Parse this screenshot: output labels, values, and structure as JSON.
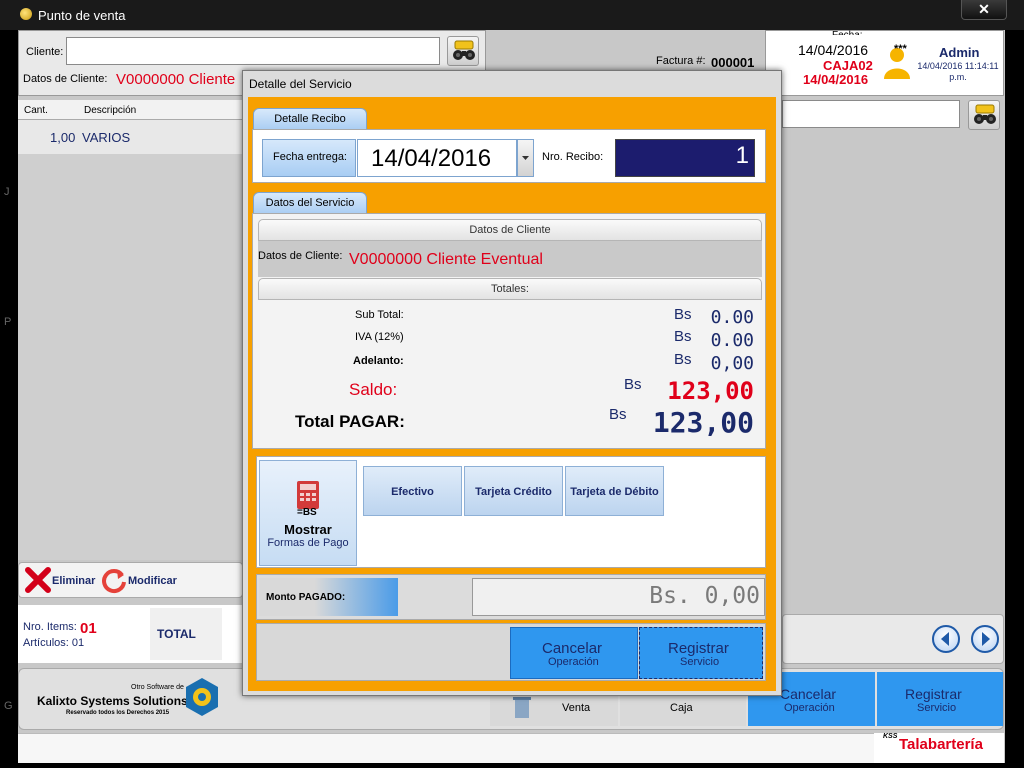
{
  "window": {
    "title": "Punto de venta",
    "close_glyph": "✕"
  },
  "customer": {
    "label": "Cliente:",
    "value": "",
    "data_label": "Datos de Cliente:",
    "data_value": "V0000000  Cliente"
  },
  "invoice": {
    "label": "Factura #:",
    "number": "000001"
  },
  "info": {
    "fecha_label": "Fecha:",
    "date": "14/04/2016",
    "caja": "CAJA02",
    "date2": "14/04/2016",
    "stars": "***",
    "user": "Admin",
    "timestamp": "14/04/2016 11:14:11 p.m."
  },
  "grid": {
    "columns": [
      "Cant.",
      "Descripción"
    ],
    "rows": [
      {
        "qty": "1,00",
        "desc": "VARIOS"
      }
    ]
  },
  "left_marks": [
    "J",
    "P",
    "G"
  ],
  "actions": {
    "delete": "Eliminar",
    "modify": "Modificar"
  },
  "totals": {
    "items_label": "Nro. Items:",
    "items_value": "01",
    "articles_label": "Artículos: 01",
    "total_label": "TOTAL"
  },
  "footer": {
    "logo_small": "Otro Software de",
    "logo_main": "Kalixto Systems Solutions",
    "logo_rights": "Reservado todos los Derechos 2015",
    "venta": "Venta",
    "caja": "Caja",
    "cancel_main": "Cancelar",
    "cancel_sub": "Operación",
    "register_main": "Registrar",
    "register_sub": "Servicio"
  },
  "brand": {
    "kss": "KSS",
    "name": "Talabartería"
  },
  "dialog": {
    "title": "Detalle del Servicio",
    "tab_recibo": "Detalle Recibo",
    "fecha_label": "Fecha entrega:",
    "fecha_value": "14/04/2016",
    "recibo_label": "Nro. Recibo:",
    "recibo_value": "1",
    "tab_servicio": "Datos del Servicio",
    "cliente_head": "Datos de Cliente",
    "cliente_label": "Datos de Cliente:",
    "cliente_value": "V0000000 Cliente Eventual",
    "totales_head": "Totales:",
    "subtotal_label": "Sub Total:",
    "subtotal_value": "0.00",
    "iva_label": "IVA (12%)",
    "iva_value": "0.00",
    "adelanto_label": "Adelanto:",
    "adelanto_value": "0,00",
    "saldo_label": "Saldo:",
    "saldo_value": "123,00",
    "total_label": "Total PAGAR:",
    "total_value": "123,00",
    "currency": "Bs",
    "mostrar_eq": "=BS",
    "mostrar_main": "Mostrar",
    "mostrar_sub": "Formas de Pago",
    "pay_methods": [
      "Efectivo",
      "Tarjeta Crédito",
      "Tarjeta de Débito"
    ],
    "monto_label": "Monto PAGADO:",
    "monto_value": "Bs. 0,00",
    "cancel_main": "Cancelar",
    "cancel_sub": "Operación",
    "register_main": "Registrar",
    "register_sub": "Servicio"
  },
  "colors": {
    "accent_orange": "#f7a000",
    "button_blue": "#2f97ef",
    "alert_red": "#e0001a",
    "navy": "#1b2a6b"
  }
}
